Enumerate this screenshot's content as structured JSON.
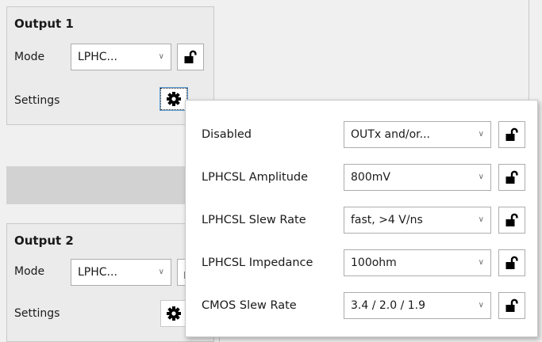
{
  "output1": {
    "title": "Output 1",
    "mode_label": "Mode",
    "mode_value": "LPHC...",
    "settings_label": "Settings"
  },
  "output2": {
    "title": "Output 2",
    "mode_label": "Mode",
    "mode_value": "LPHC...",
    "settings_label": "Settings"
  },
  "settings_popup": {
    "rows": [
      {
        "label": "Disabled",
        "value": "OUTx and/or..."
      },
      {
        "label": "LPHCSL Amplitude",
        "value": "800mV"
      },
      {
        "label": "LPHCSL Slew Rate",
        "value": "fast, >4 V/ns"
      },
      {
        "label": "LPHCSL Impedance",
        "value": "100ohm"
      },
      {
        "label": "CMOS Slew Rate",
        "value": "3.4 / 2.0 / 1.9"
      }
    ]
  },
  "icons": {
    "lock": "unlocked-padlock-icon",
    "gear": "gear-icon",
    "dropdown": "chevron-down-icon"
  }
}
